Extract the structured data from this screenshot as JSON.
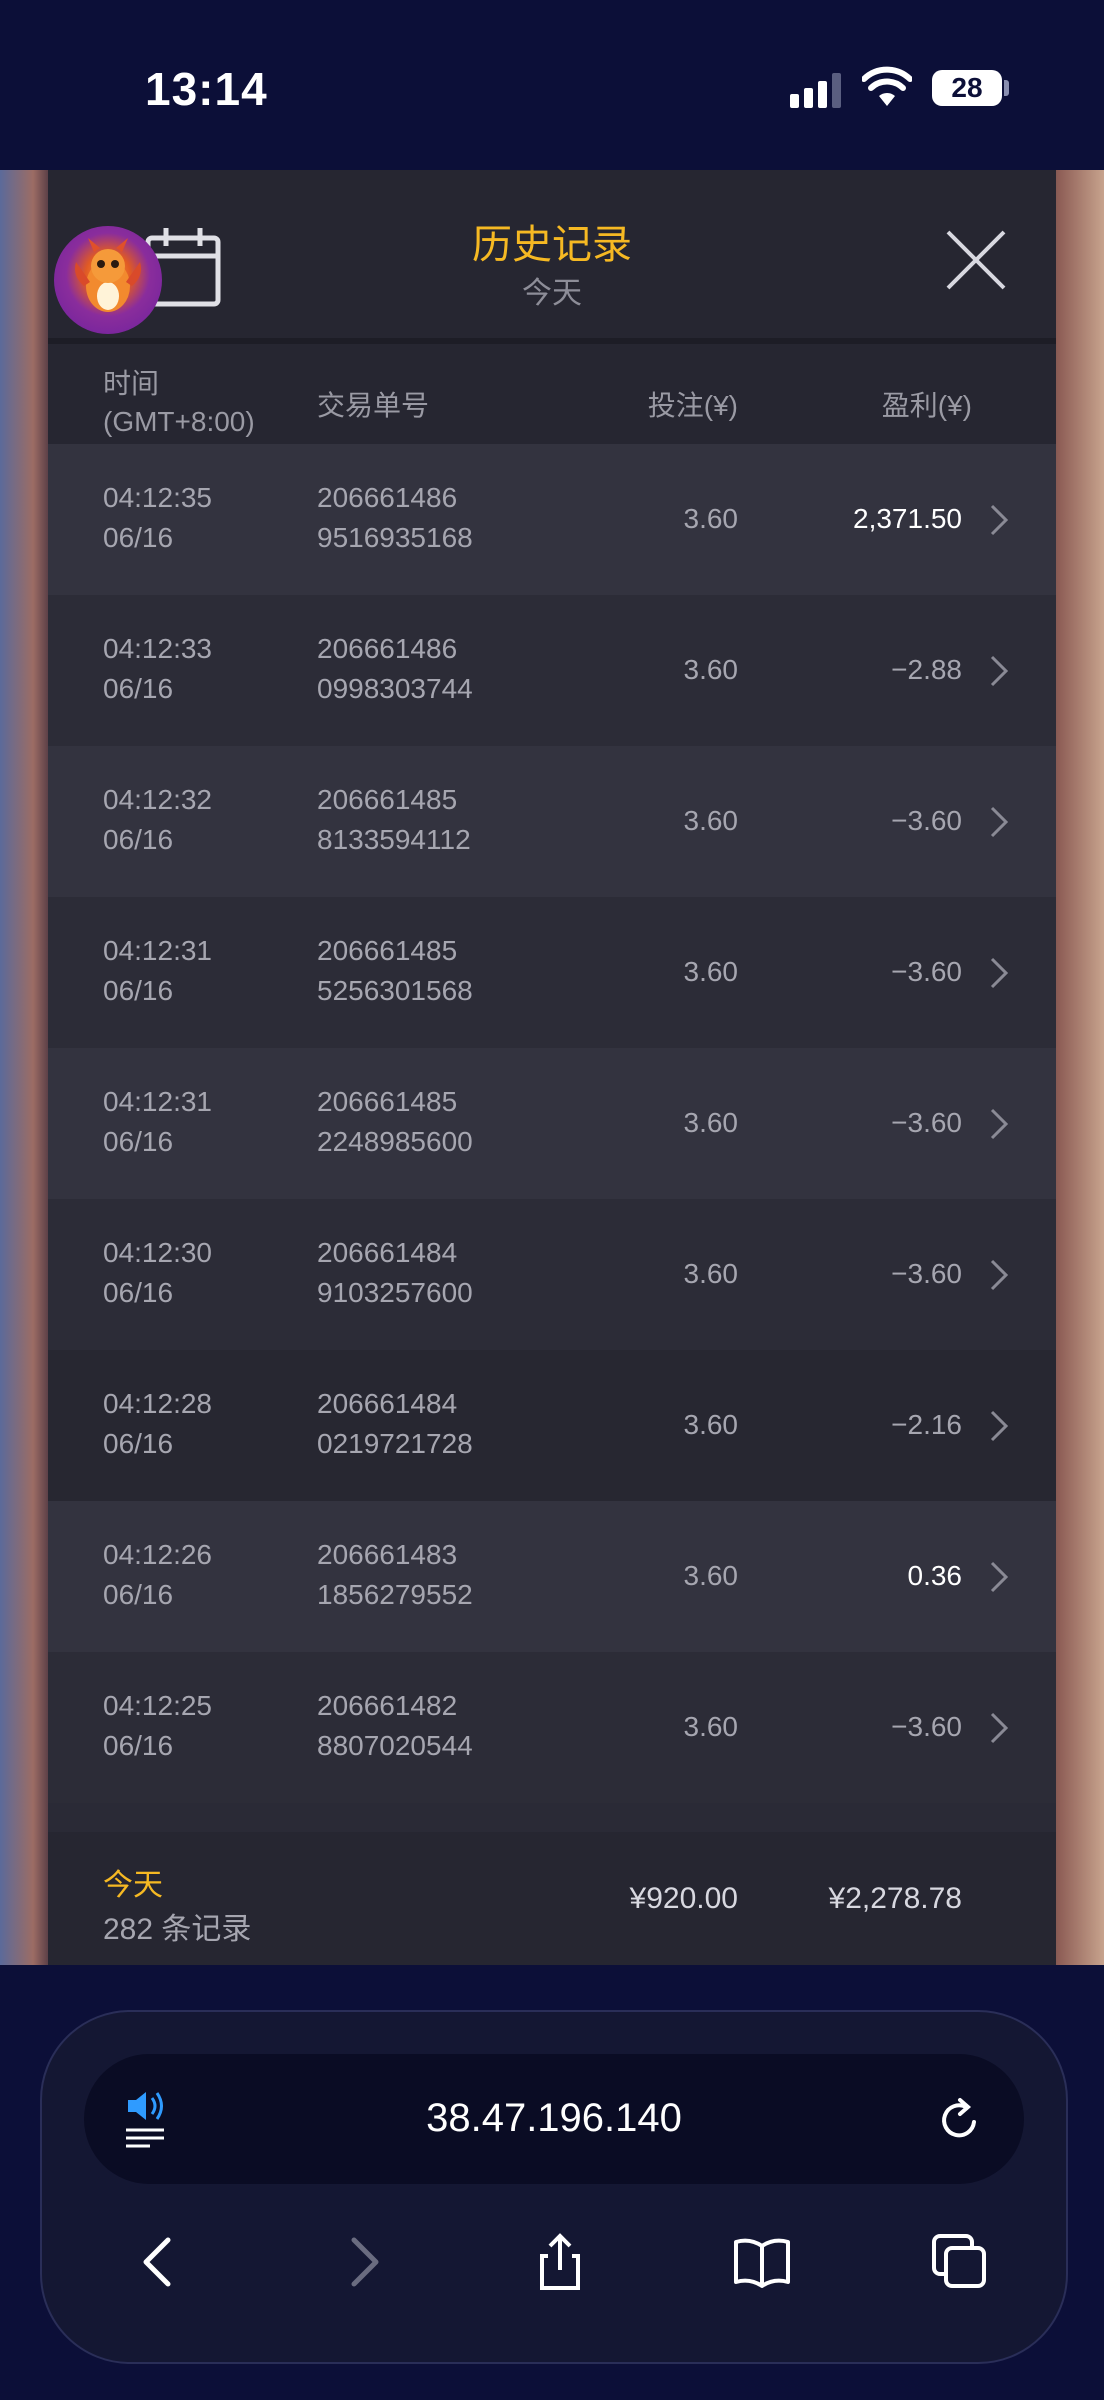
{
  "status_bar": {
    "time": "13:14",
    "battery": "28"
  },
  "panel": {
    "title": "历史记录",
    "subtitle": "今天"
  },
  "columns": {
    "time": "时间",
    "timezone": "(GMT+8:00)",
    "order": "交易单号",
    "bet": "投注(¥)",
    "profit": "盈利(¥)"
  },
  "rows": [
    {
      "time": "04:12:35",
      "date": "06/16",
      "order1": "206661486",
      "order2": "9516935168",
      "bet": "3.60",
      "profit": "2,371.50"
    },
    {
      "time": "04:12:33",
      "date": "06/16",
      "order1": "206661486",
      "order2": "0998303744",
      "bet": "3.60",
      "profit": "−2.88"
    },
    {
      "time": "04:12:32",
      "date": "06/16",
      "order1": "206661485",
      "order2": "8133594112",
      "bet": "3.60",
      "profit": "−3.60"
    },
    {
      "time": "04:12:31",
      "date": "06/16",
      "order1": "206661485",
      "order2": "5256301568",
      "bet": "3.60",
      "profit": "−3.60"
    },
    {
      "time": "04:12:31",
      "date": "06/16",
      "order1": "206661485",
      "order2": "2248985600",
      "bet": "3.60",
      "profit": "−3.60"
    },
    {
      "time": "04:12:30",
      "date": "06/16",
      "order1": "206661484",
      "order2": "9103257600",
      "bet": "3.60",
      "profit": "−3.60"
    },
    {
      "time": "04:12:28",
      "date": "06/16",
      "order1": "206661484",
      "order2": "0219721728",
      "bet": "3.60",
      "profit": "−2.16"
    },
    {
      "time": "04:12:26",
      "date": "06/16",
      "order1": "206661483",
      "order2": "1856279552",
      "bet": "3.60",
      "profit": "0.36"
    },
    {
      "time": "04:12:25",
      "date": "06/16",
      "order1": "206661482",
      "order2": "8807020544",
      "bet": "3.60",
      "profit": "−3.60"
    }
  ],
  "summary": {
    "label": "今天",
    "count": "282 条记录",
    "total_bet": "¥920.00",
    "total_profit": "¥2,278.78"
  },
  "browser": {
    "url": "38.47.196.140"
  },
  "colors": {
    "accent": "#f6b923",
    "panel": "#2a2a36",
    "background": "#0c0f38"
  }
}
